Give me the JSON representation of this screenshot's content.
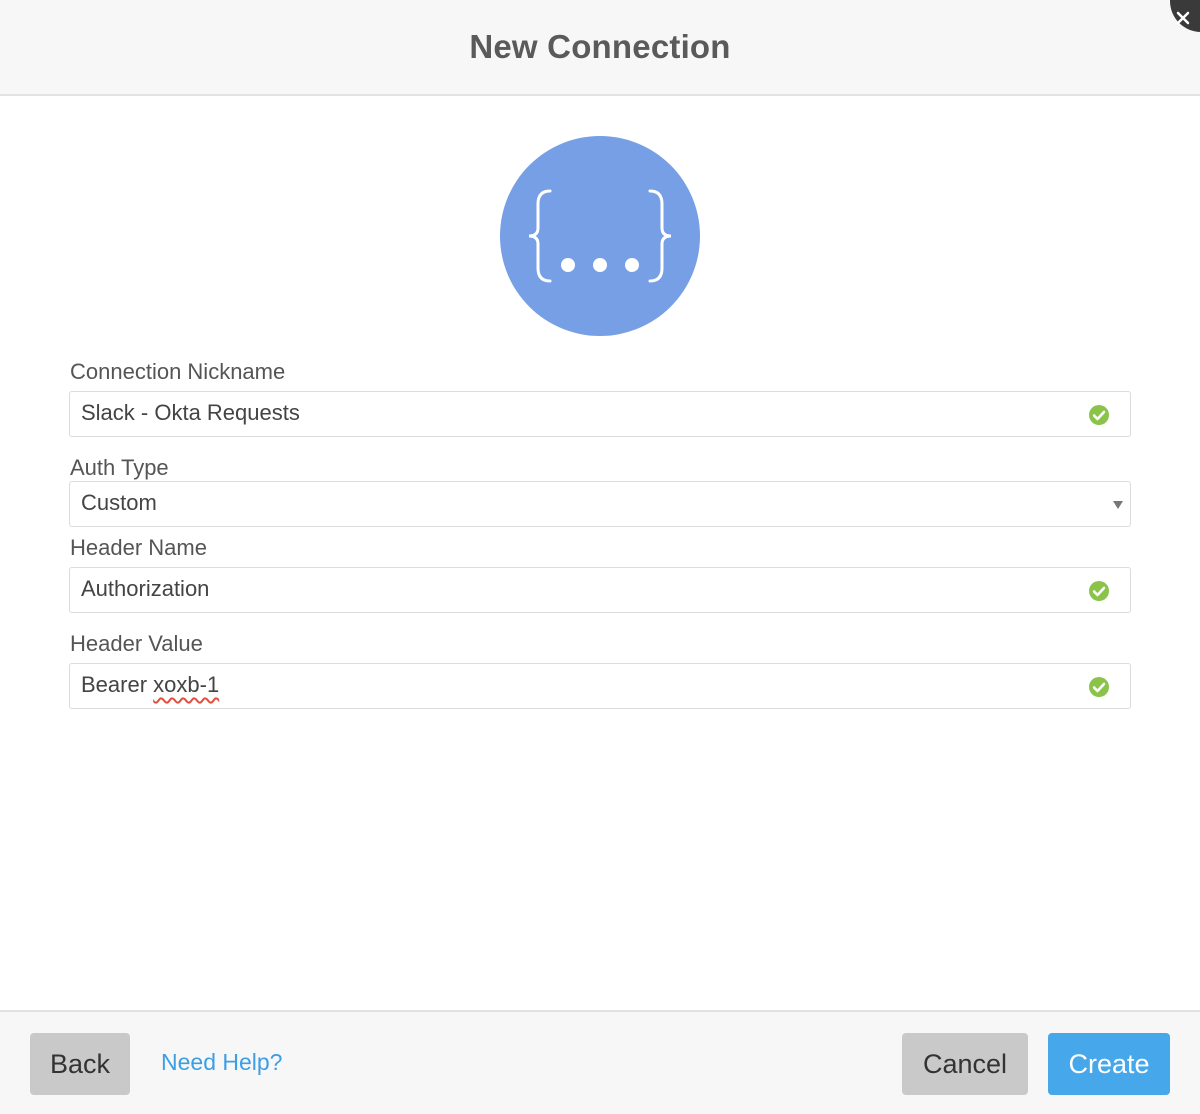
{
  "dialog": {
    "title": "New Connection"
  },
  "form": {
    "nickname": {
      "label": "Connection Nickname",
      "value": "Slack - Okta Requests"
    },
    "auth_type": {
      "label": "Auth Type",
      "value": "Custom"
    },
    "header_name": {
      "label": "Header Name",
      "value": "Authorization"
    },
    "header_value": {
      "label": "Header Value",
      "value_plain": "Bearer ",
      "value_misspelled": "xoxb-1"
    }
  },
  "footer": {
    "back_label": "Back",
    "help_label": "Need Help?",
    "cancel_label": "Cancel",
    "create_label": "Create"
  },
  "colors": {
    "accent": "#46a7ea",
    "logo_bg": "#769fe6",
    "valid": "#8bc34a"
  },
  "icons": {
    "logo": "curly-braces-ellipsis-icon",
    "valid": "check-circle-icon",
    "dropdown": "caret-down-icon"
  }
}
